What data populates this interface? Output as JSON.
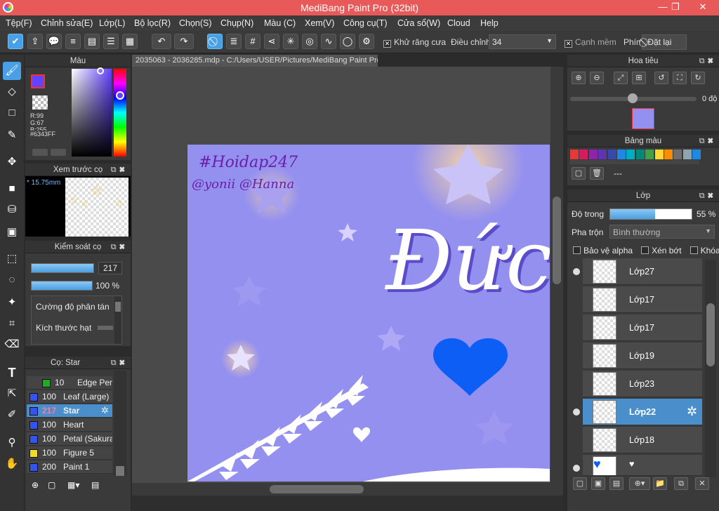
{
  "window": {
    "title": "MediBang Paint Pro (32bit)",
    "minimize": "—",
    "restore": "❐",
    "close": "✕"
  },
  "menu": [
    "Tệp(F)",
    "Chỉnh sửa(E)",
    "Lớp(L)",
    "Bộ lọc(R)",
    "Chọn(S)",
    "Chụp(N)",
    "Màu (C)",
    "Xem(V)",
    "Công cụ(T)",
    "Cửa sổ(W)",
    "Cloud",
    "Help"
  ],
  "toolbar": {
    "antialias_label": "Khử răng cưa",
    "adjust_label": "Điều chỉnh",
    "adjust_value": "34",
    "soft_edge_label": "Cạnh mềm",
    "key_label": "Phím",
    "reset_label": "Đặt lại"
  },
  "document": {
    "tab": "2035063 - 2036285.mdp - C:/Users/USER/Pictures/MediBang Paint Pro"
  },
  "color_panel": {
    "title": "Màu",
    "r": "R:99",
    "g": "G:67",
    "b": "B:255",
    "hex": "#6343FF",
    "color": "#6343FF"
  },
  "brush_preview": {
    "title": "Xem trước cọ",
    "size": "15.75mm"
  },
  "brush_control": {
    "title": "Kiểm soát cọ",
    "size_value": "217",
    "opacity_value": "100 %",
    "density_label": "Cường độ phân tán",
    "particle_label": "Kích thước hạt"
  },
  "brush_list": {
    "title": "Cọ: Star",
    "items": [
      {
        "size": "10",
        "name": "Edge Pen",
        "color": "#22aa22"
      },
      {
        "size": "100",
        "name": "Leaf (Large)",
        "color": "#3355ee"
      },
      {
        "size": "217",
        "name": "Star",
        "color": "#3355ee"
      },
      {
        "size": "100",
        "name": "Heart",
        "color": "#3355ee"
      },
      {
        "size": "100",
        "name": "Petal (Sakura)",
        "color": "#3355ee"
      },
      {
        "size": "100",
        "name": "Figure 5",
        "color": "#eedd22"
      },
      {
        "size": "200",
        "name": "Paint 1",
        "color": "#3355ee"
      }
    ]
  },
  "navigator": {
    "title": "Hoa tiêu",
    "angle": "0 độ"
  },
  "palette": {
    "title": "Bảng màu",
    "placeholder": "---",
    "colors": [
      "#e53935",
      "#d81b60",
      "#8e24aa",
      "#5e35b1",
      "#3949ab",
      "#1e88e5",
      "#00acc1",
      "#00897b",
      "#43a047",
      "#fdd835",
      "#fb8c00",
      "#6d6d6d",
      "#90a4ae",
      "#1e88e5"
    ]
  },
  "layer_panel": {
    "title": "Lớp",
    "opacity_label": "Độ trong",
    "opacity_value": "55 %",
    "opacity_fraction": 0.55,
    "blend_label": "Pha trộn",
    "blend_value": "Bình thường",
    "protect_alpha": "Bảo vệ alpha",
    "clipping": "Xén bớt",
    "lock": "Khóa",
    "layers": [
      {
        "name": "Lớp27",
        "visible": true
      },
      {
        "name": "Lớp17",
        "visible": false
      },
      {
        "name": "Lớp17",
        "visible": false
      },
      {
        "name": "Lớp19",
        "visible": false
      },
      {
        "name": "Lớp23",
        "visible": false
      },
      {
        "name": "Lớp22",
        "visible": true,
        "selected": true
      },
      {
        "name": "Lớp18",
        "visible": false
      }
    ]
  },
  "artwork": {
    "tag1": "#Hoidap247",
    "tag2": "@yonii @Hanna",
    "word": "Đức"
  }
}
